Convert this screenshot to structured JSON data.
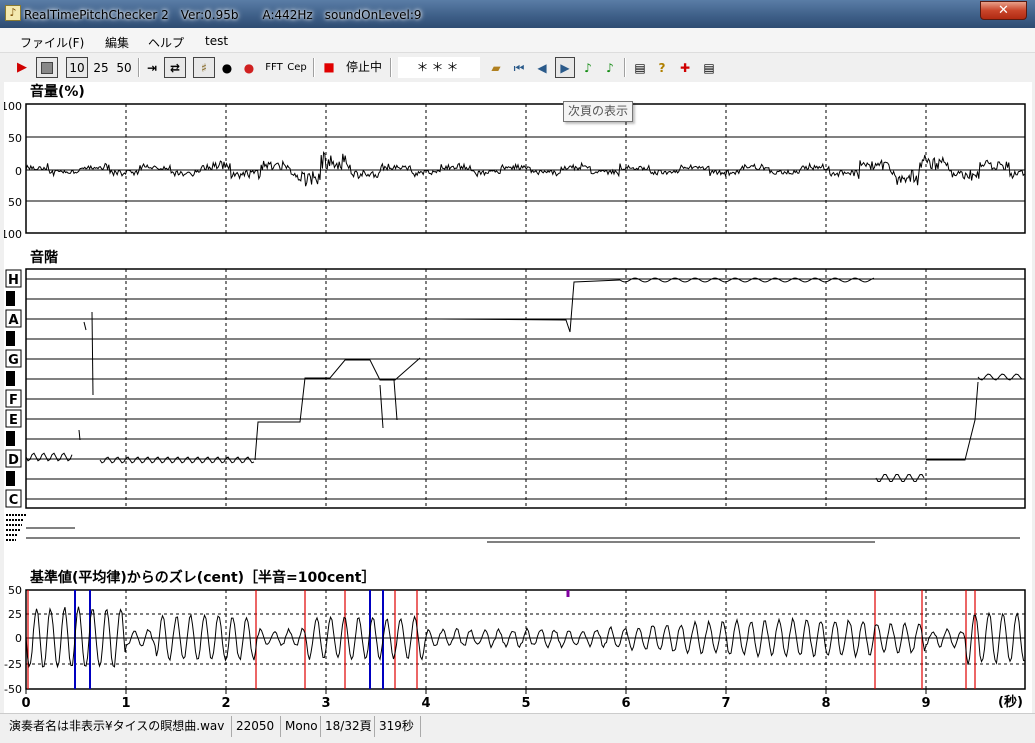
{
  "window": {
    "title": "RealTimePitchChecker 2　Ver:0.95b　　A:442Hz　soundOnLevel:9",
    "close": "✕"
  },
  "menu": [
    "ファイル(F)",
    "編集",
    "ヘルプ",
    "test"
  ],
  "toolbar": {
    "speeds": [
      "10",
      "25",
      "50"
    ],
    "fft": "FFT",
    "cep": "Cep",
    "status": "停止中",
    "stars": "＊＊＊"
  },
  "tooltip": "次頁の表示",
  "panels": {
    "volume": {
      "title": "音量(%)",
      "ticks": [
        "100",
        "50",
        "0",
        "50",
        "100"
      ]
    },
    "scale": {
      "title": "音階",
      "notes": [
        "H",
        "A",
        "G",
        "F",
        "E",
        "D",
        "C"
      ]
    },
    "cent": {
      "title": "基準値(平均律)からのズレ(cent)［半音=100cent］",
      "ticks": [
        "50",
        "25",
        "0",
        "-25",
        "-50"
      ]
    }
  },
  "xaxis": {
    "ticks": [
      "0",
      "1",
      "2",
      "3",
      "4",
      "5",
      "6",
      "7",
      "8",
      "9"
    ],
    "unit": "(秒)"
  },
  "status": [
    "演奏者名は非表示¥タイスの瞑想曲.wav",
    "22050",
    "Mono",
    "18/32頁",
    "319秒"
  ],
  "colors": {
    "red": "#e00000",
    "blue": "#0000c0",
    "purple": "#8000a0",
    "grid": "#000"
  }
}
